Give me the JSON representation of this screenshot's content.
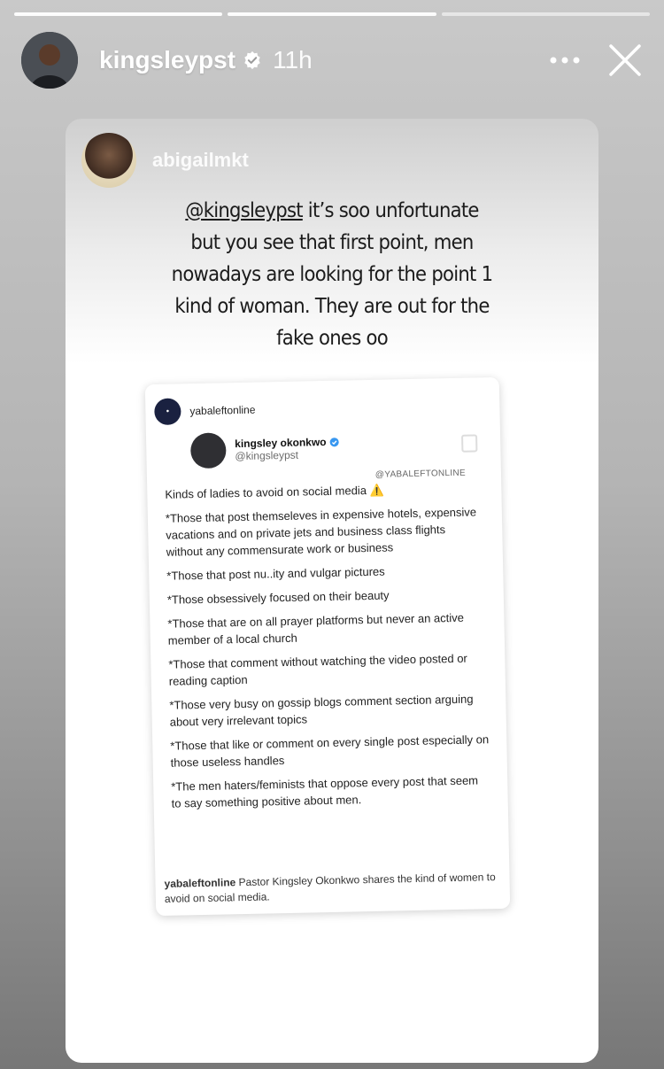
{
  "story": {
    "segments": 3,
    "active_segment": 2,
    "user": "kingsleypst",
    "time": "11h",
    "icons": {
      "verified": "verified-badge-icon",
      "more": "more-icon",
      "close": "close-icon"
    }
  },
  "reply": {
    "username": "abigailmkt",
    "mention": "@kingsleypst",
    "text_lines": [
      " it’s soo unfortunate",
      "but you see that first point, men",
      "nowadays are looking for the point 1",
      "kind of woman. They are out for the",
      "fake ones oo"
    ]
  },
  "post": {
    "account": "yabaleftonline",
    "tweet": {
      "name": "kingsley okonkwo",
      "handle": "@kingsleypst",
      "watermark": "@YABALEFTONLINE",
      "lines": [
        "Kinds of ladies to avoid on social media ⚠️",
        "*Those that post themseleves in expensive hotels, expensive vacations and on private jets and business class flights without any commensurate work or business",
        "*Those that post nu..ity and vulgar pictures",
        "*Those obsessively focused on their beauty",
        "*Those that are on all prayer platforms but never an active member of a local church",
        "*Those that comment without watching the video posted or reading caption",
        "*Those very busy on gossip blogs comment section arguing about very irrelevant topics",
        "*Those that like or comment on every single post especially on those useless handles",
        "*The men haters/feminists that oppose every post that seem to say something positive about men."
      ]
    },
    "caption_account": "yabaleftonline",
    "caption_text": " Pastor Kingsley Okonkwo shares the kind of women to avoid on social media."
  },
  "colors": {
    "verified_blue": "#3897f0",
    "white": "#ffffff"
  }
}
